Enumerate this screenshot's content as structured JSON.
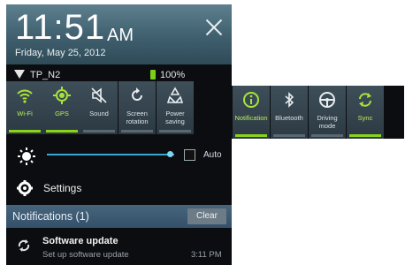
{
  "lock": {
    "time": "11:51",
    "ampm": "AM",
    "date": "Friday, May 25, 2012"
  },
  "status": {
    "ssid": "TP_N2",
    "battery": "100%"
  },
  "quick_settings": [
    {
      "label": "Wi-Fi",
      "icon": "wifi-icon",
      "on": true
    },
    {
      "label": "GPS",
      "icon": "gps-icon",
      "on": true
    },
    {
      "label": "Sound",
      "icon": "sound-muted-icon",
      "on": false
    },
    {
      "label": "Screen rotation",
      "icon": "rotation-icon",
      "on": false
    },
    {
      "label": "Power saving",
      "icon": "recycle-icon",
      "on": false
    },
    {
      "label": "Notification",
      "icon": "info-icon",
      "on": true
    },
    {
      "label": "Bluetooth",
      "icon": "bluetooth-icon",
      "on": false
    },
    {
      "label": "Driving mode",
      "icon": "steering-wheel-icon",
      "on": false
    },
    {
      "label": "Sync",
      "icon": "sync-icon",
      "on": true
    }
  ],
  "brightness": {
    "auto_label": "Auto",
    "level": 0.97
  },
  "settings": {
    "label": "Settings"
  },
  "notifications": {
    "header": "Notifications (1)",
    "clear_label": "Clear",
    "items": [
      {
        "title": "Software update",
        "subtitle": "Set up software update",
        "time": "3:11 PM"
      }
    ]
  }
}
